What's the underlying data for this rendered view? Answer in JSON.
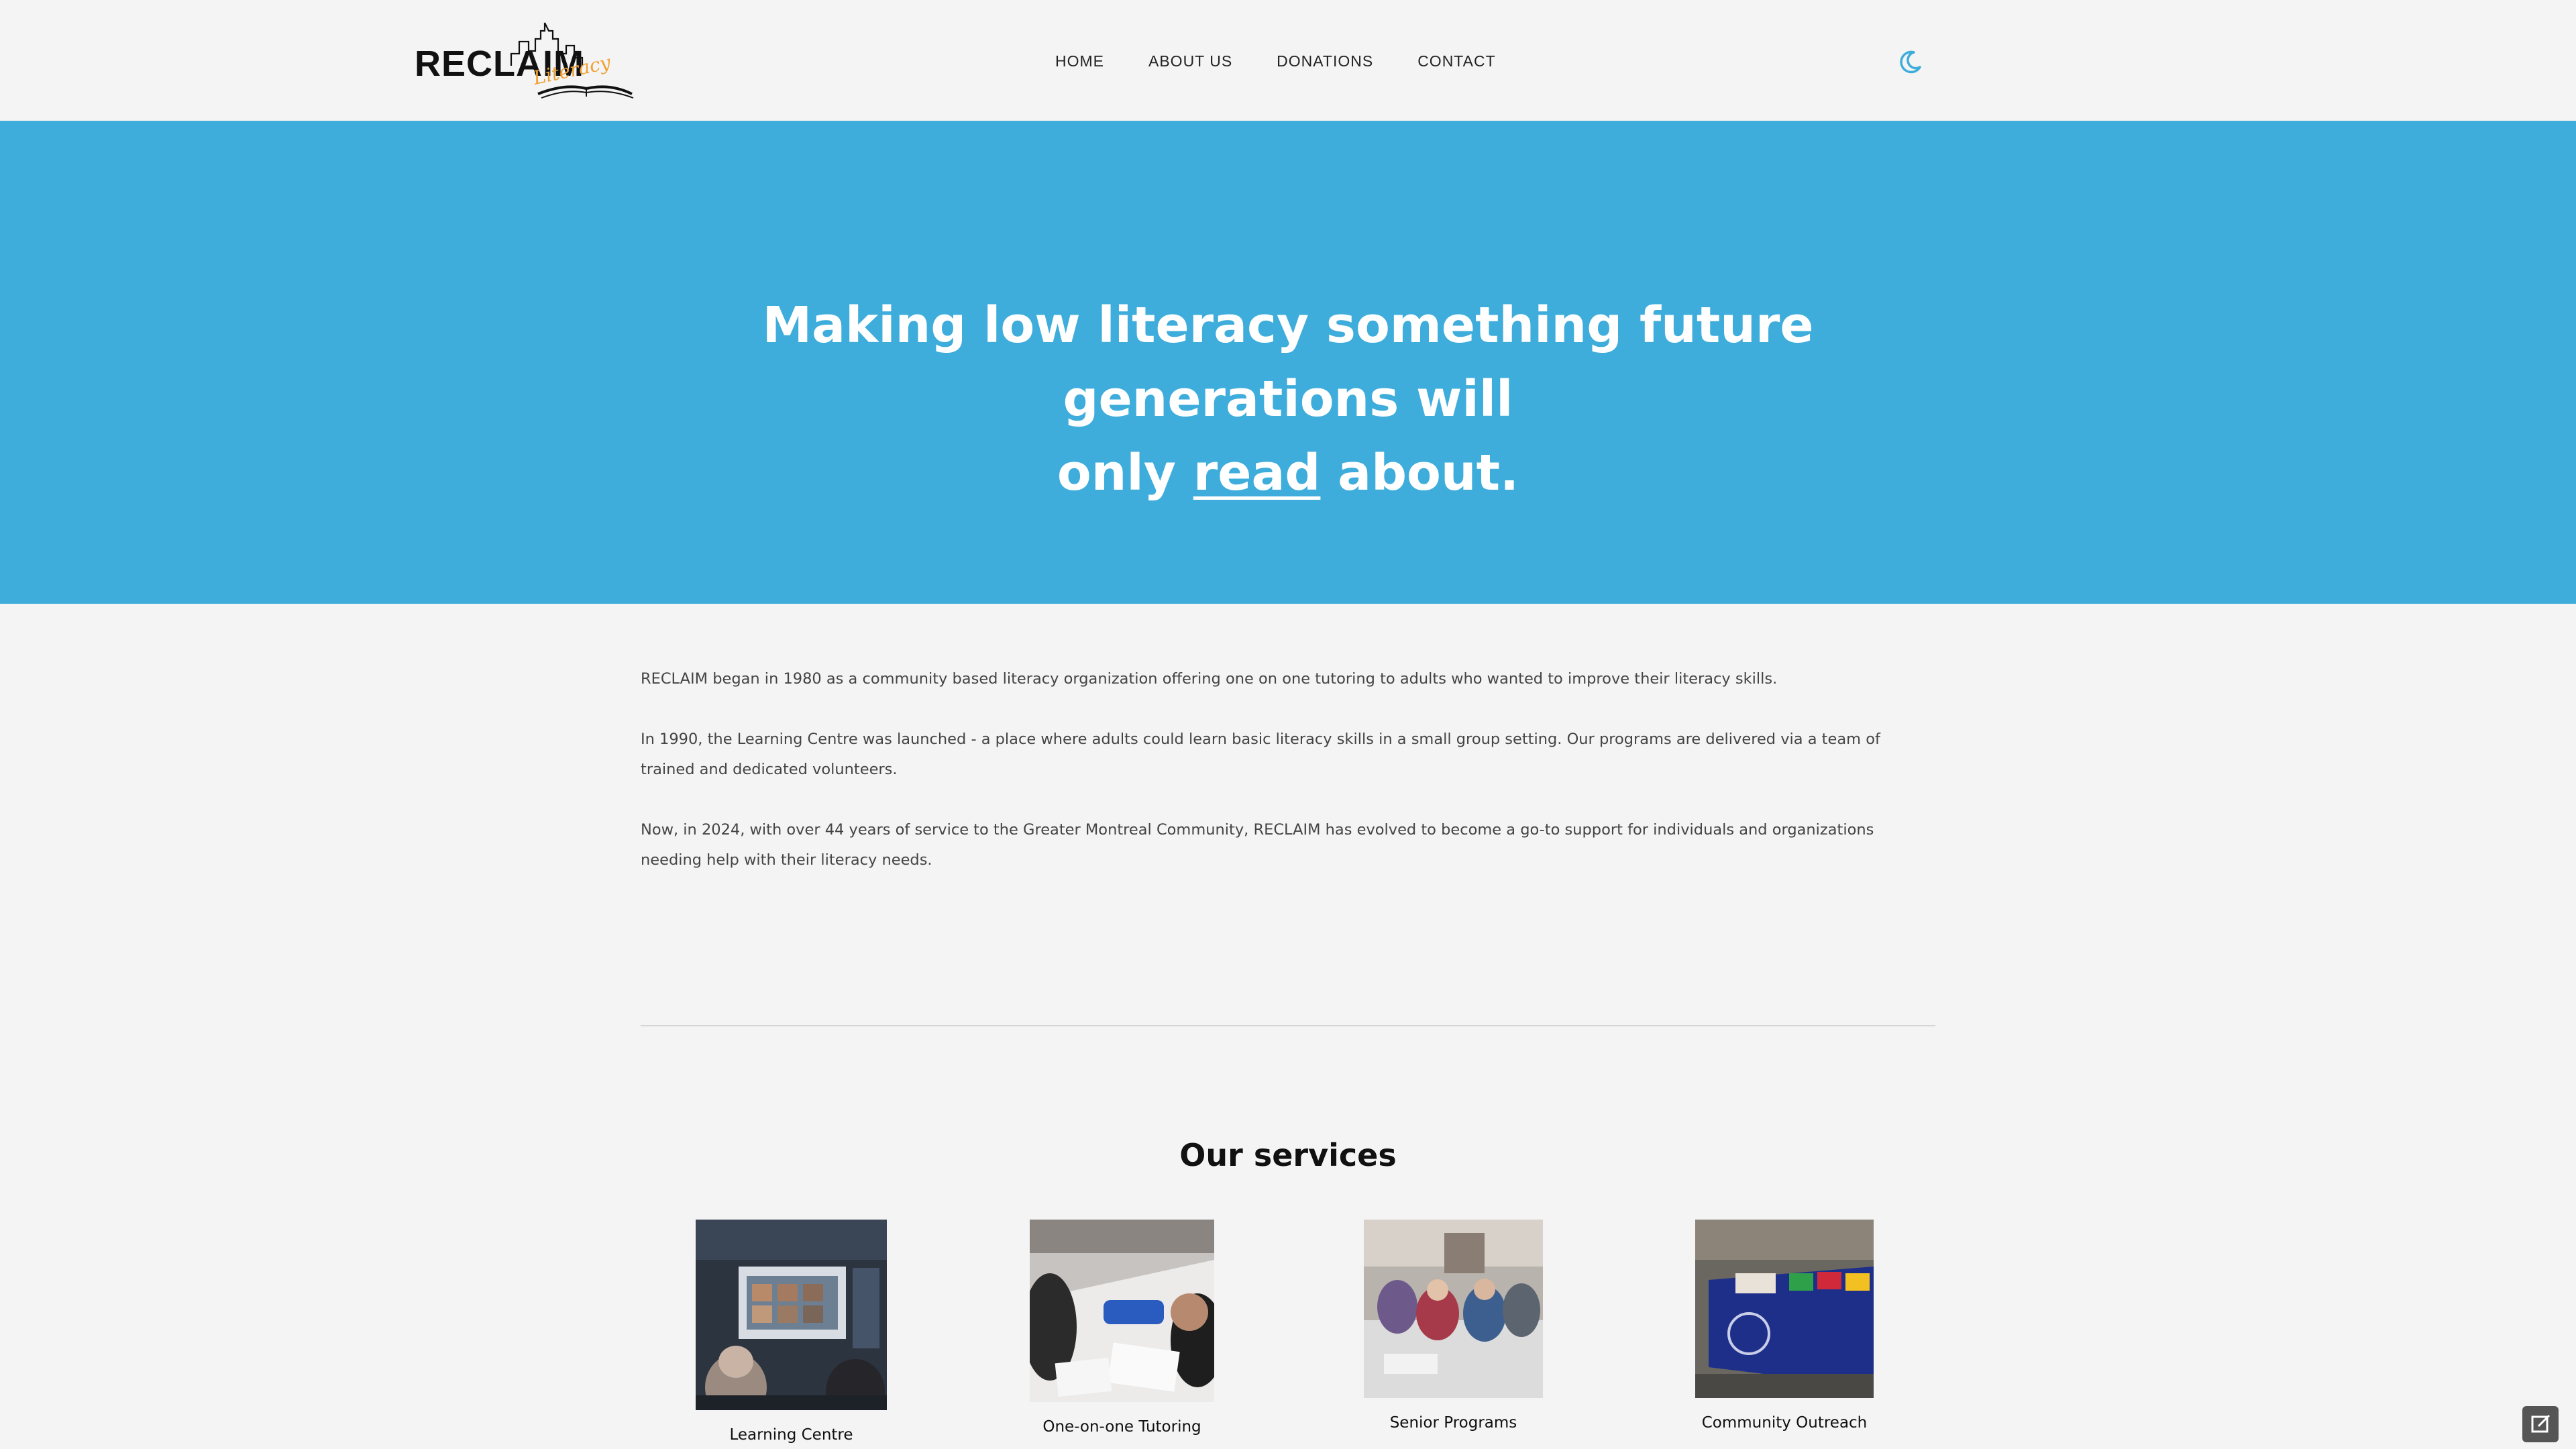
{
  "header": {
    "logo_text": "RECLAIM",
    "logo_script": "Literacy",
    "nav": [
      "HOME",
      "ABOUT US",
      "DONATIONS",
      "CONTACT"
    ],
    "theme_icon": "moon-icon"
  },
  "hero": {
    "line1": "Making low literacy something future generations will",
    "line2_pre": "only ",
    "line2_link": "read",
    "line2_post": " about."
  },
  "about": {
    "paragraphs": [
      "RECLAIM began in 1980 as a community based literacy organization offering one on one tutoring to adults who wanted to improve their literacy skills.",
      "In 1990, the Learning Centre was launched - a place where adults could learn basic literacy skills in a small group setting. Our programs are delivered via a team of trained and dedicated volunteers.",
      "Now, in 2024, with over 44 years of service to the Greater Montreal Community, RECLAIM has evolved to become a go-to support for individuals and organizations needing help with their literacy needs."
    ]
  },
  "services": {
    "title": "Our services",
    "items": [
      "Learning Centre",
      "One-on-one Tutoring",
      "Senior Programs",
      "Community Outreach"
    ]
  },
  "colors": {
    "accent": "#3eaddb",
    "background": "#f4f4f4",
    "logo_orange": "#f0a030"
  },
  "corner_icon": "edit-icon"
}
